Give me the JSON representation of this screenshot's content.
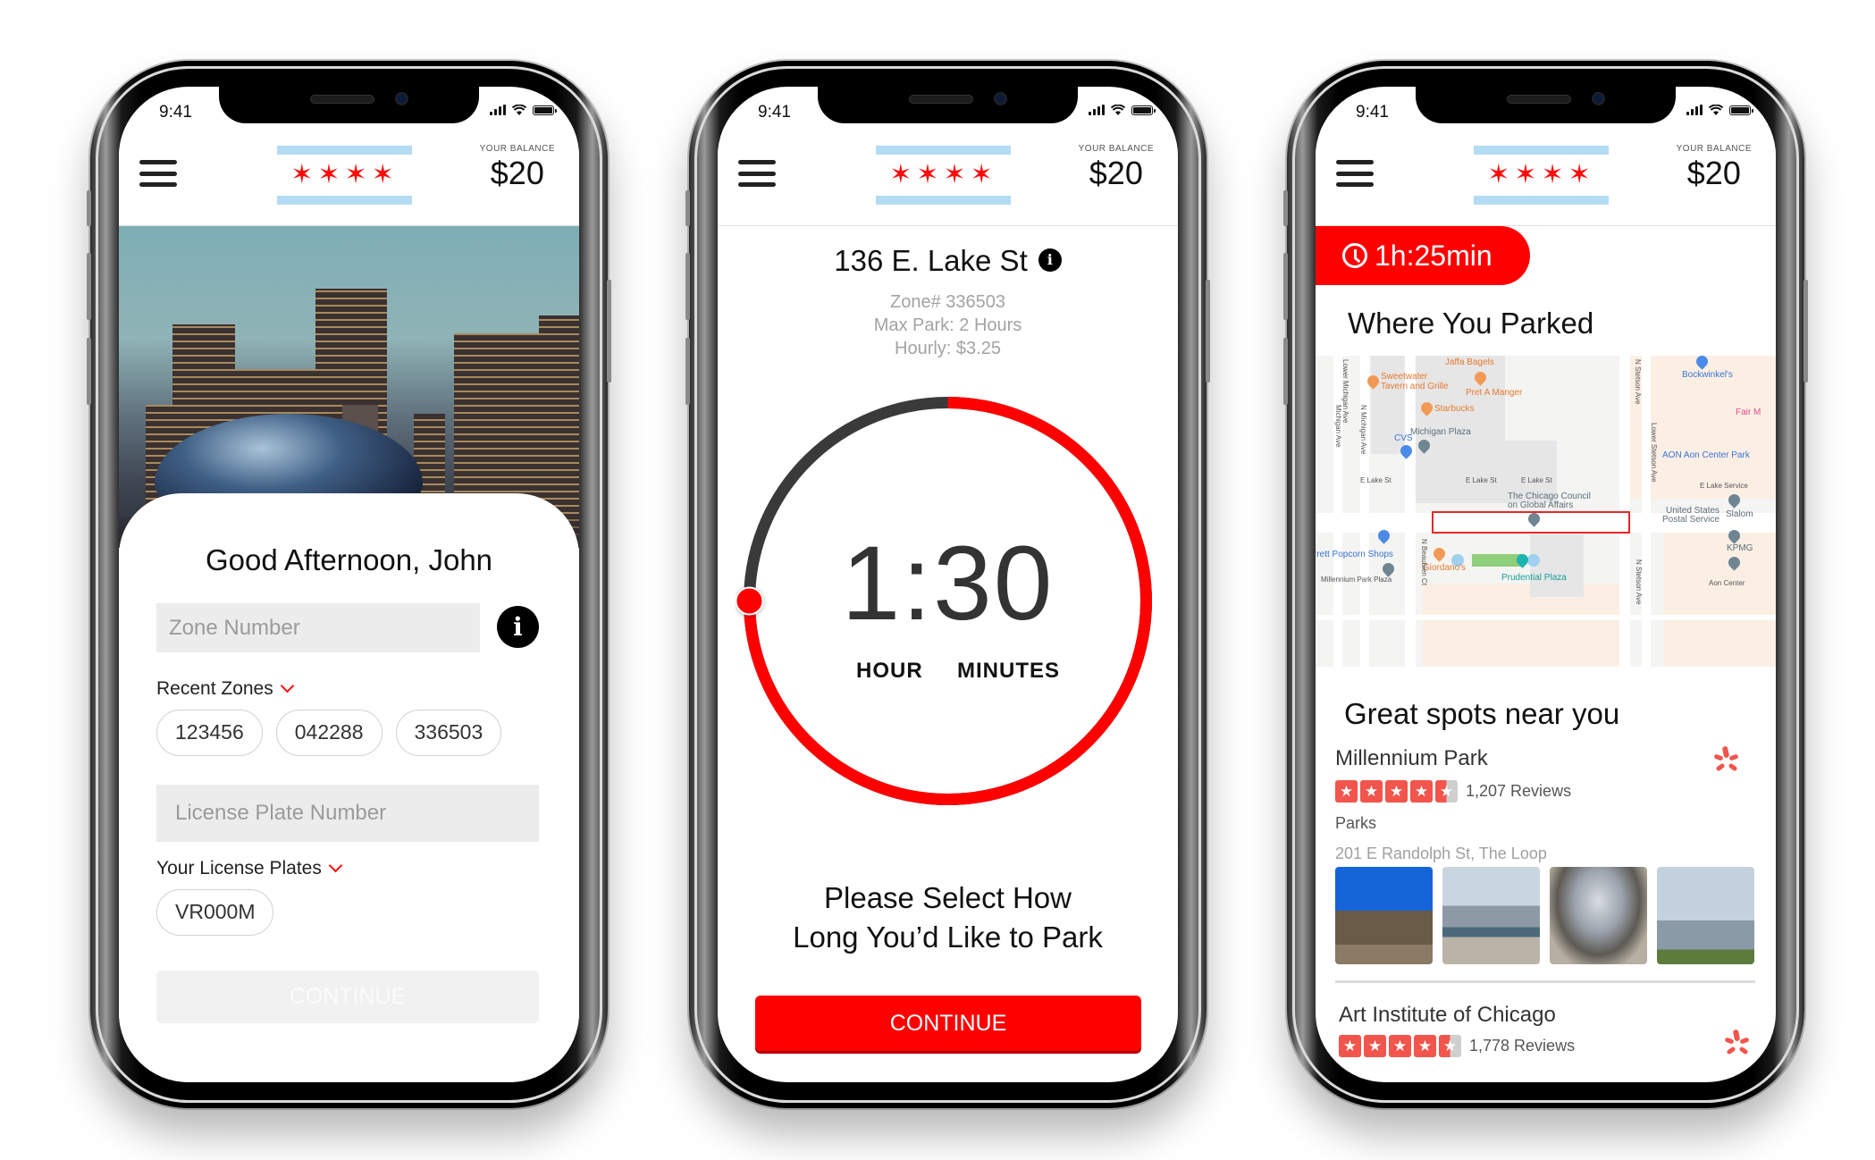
{
  "status_bar": {
    "time": "9:41"
  },
  "header": {
    "balance_label": "YOUR BALANCE",
    "balance_value": "$20",
    "logo_stars": "✶✶✶✶",
    "menu_icon": "hamburger-icon",
    "logo": "chicago-flag-logo"
  },
  "colors": {
    "accent": "#ff0000",
    "flag_blue": "#b3dcf2",
    "yelp_red": "#f2554c"
  },
  "screen1": {
    "greeting": "Good Afternoon, John",
    "zone_input": {
      "placeholder": "Zone Number",
      "value": ""
    },
    "info_icon": "i",
    "recent_zones_label": "Recent Zones",
    "recent_zones": [
      "123456",
      "042288",
      "336503"
    ],
    "plate_input": {
      "placeholder": "License Plate Number",
      "value": ""
    },
    "plates_label": "Your License Plates",
    "plates": [
      "VR000M"
    ],
    "continue_label": "CONTINUE",
    "continue_enabled": false
  },
  "screen2": {
    "address": "136 E. Lake St",
    "info_icon": "i",
    "zone": "Zone# 336503",
    "max_park": "Max Park: 2 Hours",
    "hourly": "Hourly: $3.25",
    "duration": "1:30",
    "duration_fraction_of_max": 0.75,
    "hour_label": "HOUR",
    "minutes_label": "MINUTES",
    "prompt_line1": "Please Select How",
    "prompt_line2": "Long You’d Like to Park",
    "continue_label": "CONTINUE"
  },
  "screen3": {
    "timer": "1h:25min",
    "parked_title": "Where You Parked",
    "map_labels": {
      "jaffa": "Jaffa Bagels",
      "sweetwater1": "Sweetwater",
      "sweetwater2": "Tavern and Grille",
      "pret": "Pret A Manger",
      "starbucks": "Starbucks",
      "michigan_plaza": "Michigan Plaza",
      "cvs": "CVS",
      "bockwinkels": "Bockwinkel's",
      "aon_park": "AON Aon Center Park",
      "lake_st_w": "E Lake St",
      "lake_st_c": "E Lake St",
      "lake_st_e": "E Lake St",
      "lake_service": "E Lake Service",
      "council1": "The Chicago Council",
      "council2": "on Global Affairs",
      "usps1": "United States",
      "usps2": "Postal Service",
      "slalom": "Slalom",
      "kpmg": "KPMG",
      "popcorn": "rrett Popcorn Shops",
      "giordanos": "Giordano's",
      "prudential": "Prudential Plaza",
      "mp_plaza": "Millennium Park Plaza",
      "aon_center": "Aon Center",
      "lower_mich": "Lower Michigan Ave",
      "mich_ave": "Michigan Ave",
      "n_mich": "N Michigan Ave",
      "n_stetson": "N Stetson Ave",
      "lower_stetson": "Lower Stetson Ave",
      "n_beaubien": "N Beaubien Ct",
      "n_stetson2": "N Stetson Ave",
      "fair": "Fair M"
    },
    "spots_title": "Great spots near you",
    "places": [
      {
        "name": "Millennium Park",
        "rating": 4.5,
        "reviews": "1,207 Reviews",
        "category": "Parks",
        "address": "201 E Randolph St, The Loop"
      },
      {
        "name": "Art Institute of Chicago",
        "rating": 4.5,
        "reviews": "1,778 Reviews"
      }
    ]
  }
}
